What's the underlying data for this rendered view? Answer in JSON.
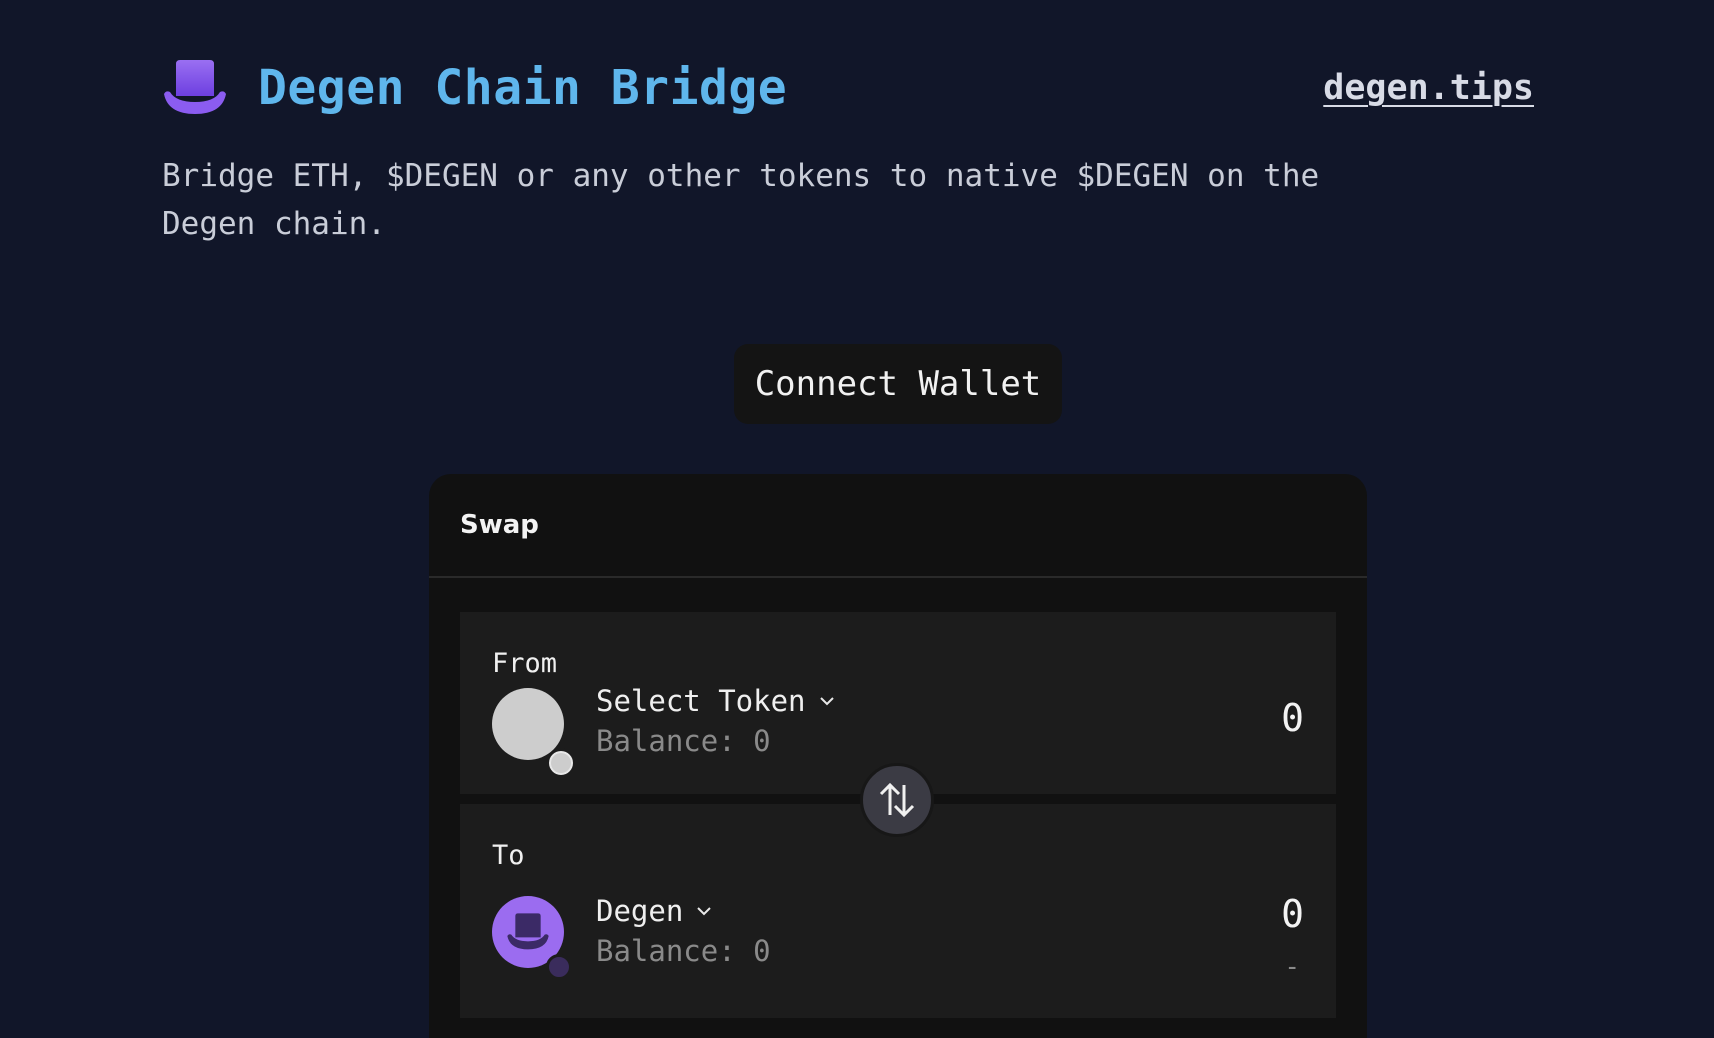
{
  "header": {
    "logo_icon": "top-hat-icon",
    "title": "Degen Chain Bridge",
    "link_label": "degen.tips"
  },
  "tagline": "Bridge ETH, $DEGEN or any other tokens to native $DEGEN on the Degen chain.",
  "connect_button": {
    "label": "Connect Wallet"
  },
  "swap": {
    "title": "Swap",
    "from": {
      "label": "From",
      "token_label": "Select Token",
      "balance": "Balance: 0",
      "amount": "0"
    },
    "switch_icon": "swap-arrows-icon",
    "to": {
      "label": "To",
      "token_label": "Degen",
      "balance": "Balance: 0",
      "amount": "0",
      "usd_value": "-"
    }
  },
  "colors": {
    "background": "#111629",
    "title": "#5fb6ec",
    "brand_purple": "#9b6cf0",
    "card": "#111111",
    "panel": "#1c1c1c"
  }
}
